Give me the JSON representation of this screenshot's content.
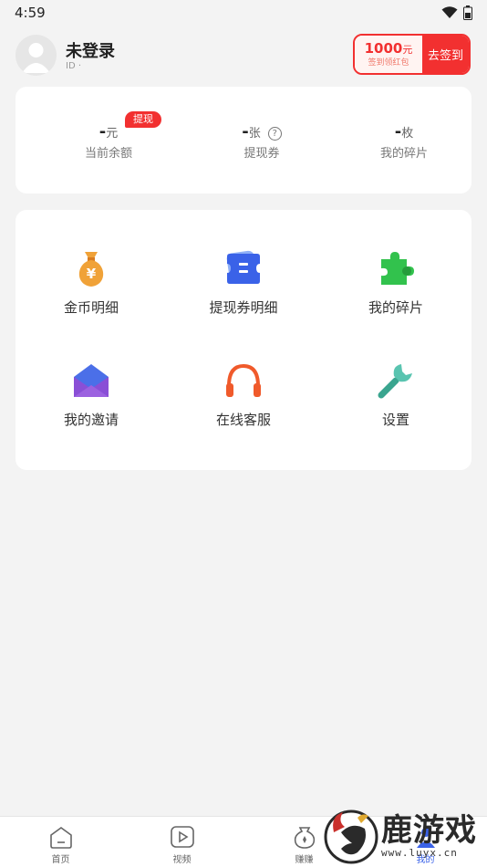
{
  "status": {
    "time": "4:59"
  },
  "profile": {
    "name": "未登录",
    "id": "ID ·"
  },
  "signin": {
    "amount": "1000",
    "unit": "元",
    "subtitle": "签到领红包",
    "button": "去签到"
  },
  "stats": {
    "badge": "提现",
    "items": [
      {
        "value": "-",
        "unit": "元",
        "label": "当前余额"
      },
      {
        "value": "-",
        "unit": "张",
        "label": "提现券"
      },
      {
        "value": "-",
        "unit": "枚",
        "label": "我的碎片"
      }
    ],
    "help_icon": "?"
  },
  "menu": {
    "items": [
      {
        "label": "金币明细",
        "icon": "money-bag-icon"
      },
      {
        "label": "提现券明细",
        "icon": "ticket-icon"
      },
      {
        "label": "我的碎片",
        "icon": "puzzle-icon"
      },
      {
        "label": "我的邀请",
        "icon": "envelope-icon"
      },
      {
        "label": "在线客服",
        "icon": "headphones-icon"
      },
      {
        "label": "设置",
        "icon": "wrench-icon"
      }
    ]
  },
  "nav": {
    "items": [
      {
        "label": "首页",
        "icon": "home-icon"
      },
      {
        "label": "视频",
        "icon": "video-icon"
      },
      {
        "label": "赚赚",
        "icon": "earn-icon"
      },
      {
        "label": "我的",
        "icon": "profile-icon",
        "active": true
      }
    ]
  },
  "watermark": {
    "text": "鹿游戏",
    "url": "www.luyx.cn"
  },
  "colors": {
    "accent": "#f23030",
    "active_nav": "#3a62e8"
  }
}
